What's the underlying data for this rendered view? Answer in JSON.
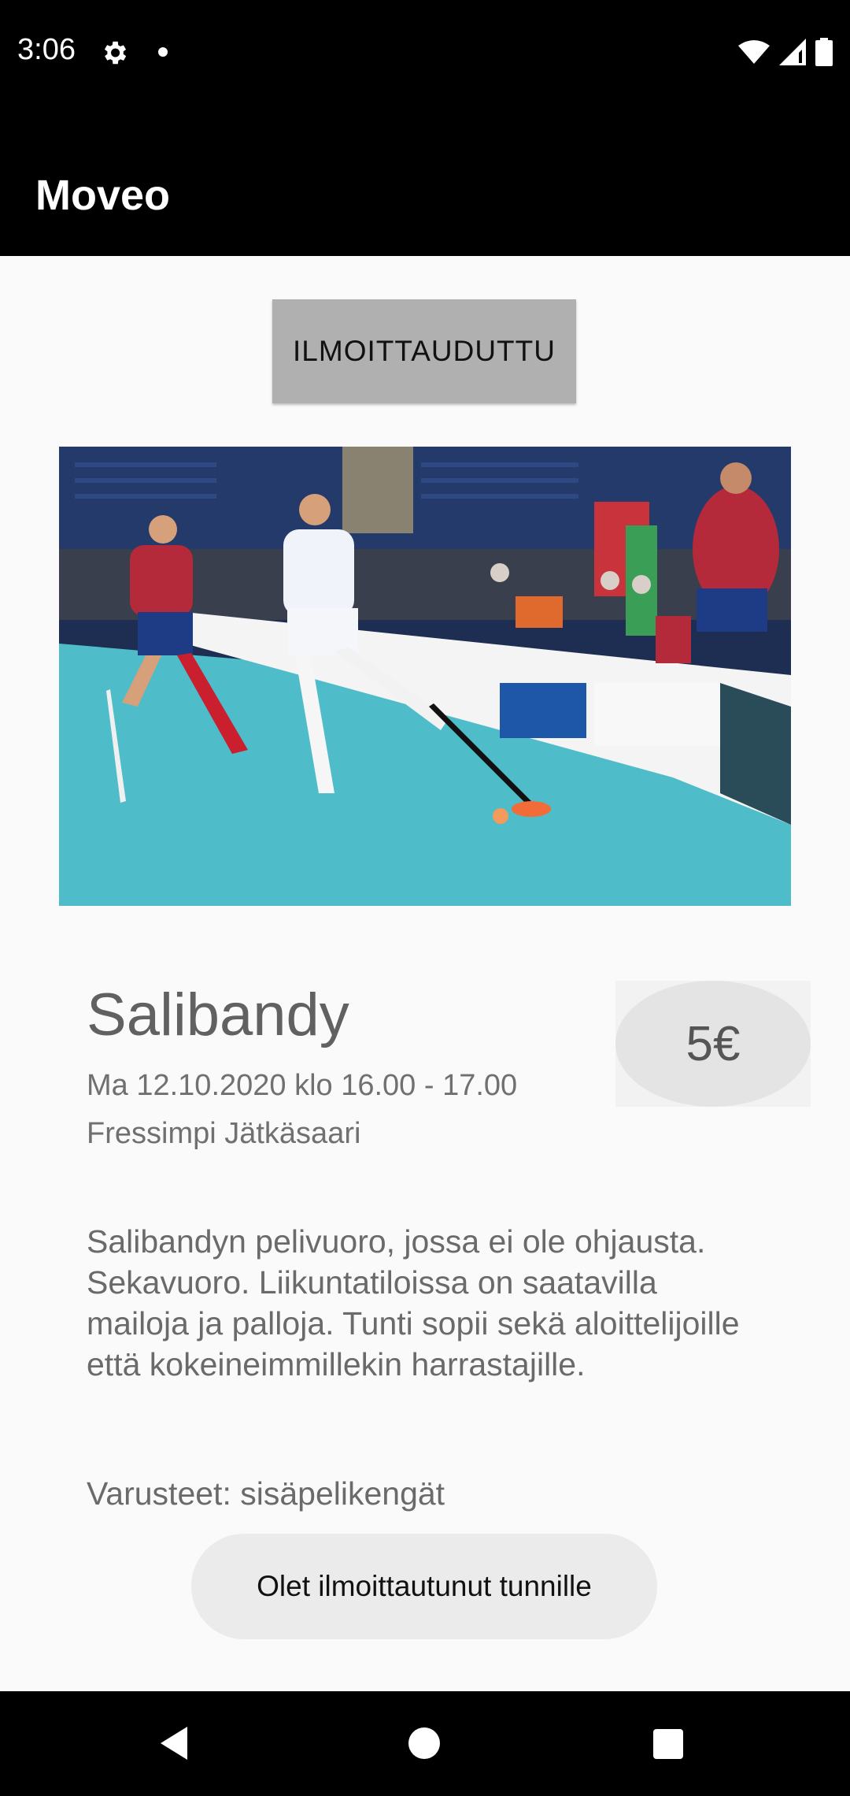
{
  "status": {
    "time": "3:06"
  },
  "app": {
    "title": "Moveo"
  },
  "signup_button": {
    "label": "ILMOITTAUDUTTU"
  },
  "event": {
    "title": "Salibandy",
    "datetime": "Ma 12.10.2020 klo 16.00 - 17.00",
    "location": "Fressimpi Jätkäsaari",
    "price": "5€",
    "description": "Salibandyn pelivuoro, jossa ei ole ohjausta. Sekavuoro. Liikuntatiloissa on saatavilla mailoja ja palloja. Tunti sopii sekä aloittelijoille että kokeineimmillekin harrastajille.",
    "equipment": "Varusteet: sisäpelikengät"
  },
  "toast": {
    "message": "Olet ilmoittautunut tunnille"
  },
  "icons": {
    "status": [
      "gear-icon",
      "dot-icon",
      "wifi-icon",
      "signal-icon",
      "battery-icon"
    ],
    "nav": [
      "back-icon",
      "home-icon",
      "recents-icon"
    ]
  },
  "colors": {
    "bar": "#000000",
    "button": "#b0b0b0",
    "court": "#4fbcc9"
  }
}
